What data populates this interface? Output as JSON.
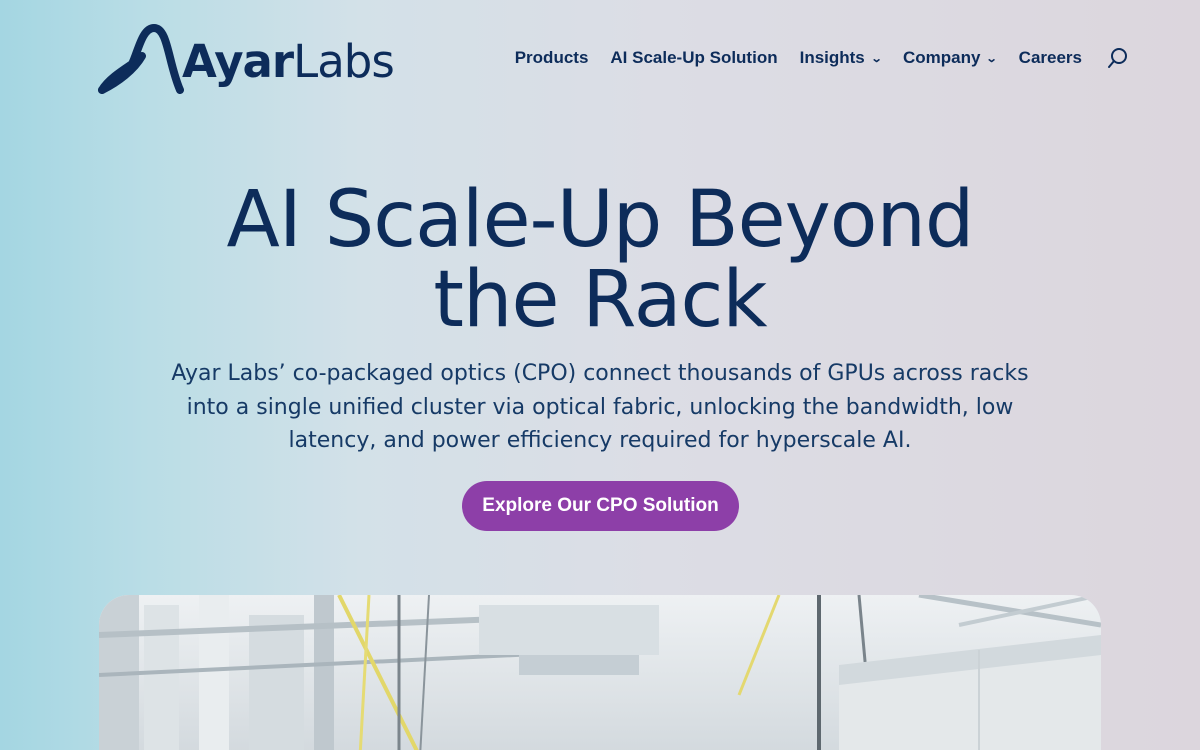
{
  "brand": {
    "name_part1": "Ayar",
    "name_part2": "Labs",
    "logo_icon": "ayar-labs-wave-logo"
  },
  "nav": {
    "items": [
      {
        "label": "Products",
        "has_dropdown": false
      },
      {
        "label": "AI Scale-Up Solution",
        "has_dropdown": false
      },
      {
        "label": "Insights",
        "has_dropdown": true
      },
      {
        "label": "Company",
        "has_dropdown": true
      },
      {
        "label": "Careers",
        "has_dropdown": false
      }
    ],
    "search_icon": "search-icon"
  },
  "hero": {
    "title_line1": "AI Scale-Up Beyond",
    "title_line2": "the Rack",
    "subtitle": "Ayar Labs’ co-packaged optics (CPO) connect thousands of GPUs across racks into a single unified cluster via optical fabric, unlocking the bandwidth, low latency, and power efficiency required for hyperscale AI.",
    "cta_label": "Explore Our CPO Solution",
    "image": "data-center-server-racks-photo"
  },
  "colors": {
    "primary_navy": "#0d2c5a",
    "cta_purple": "#8d3fa8",
    "bg_left": "#a4d6e2",
    "bg_right": "#dcd6dd"
  }
}
